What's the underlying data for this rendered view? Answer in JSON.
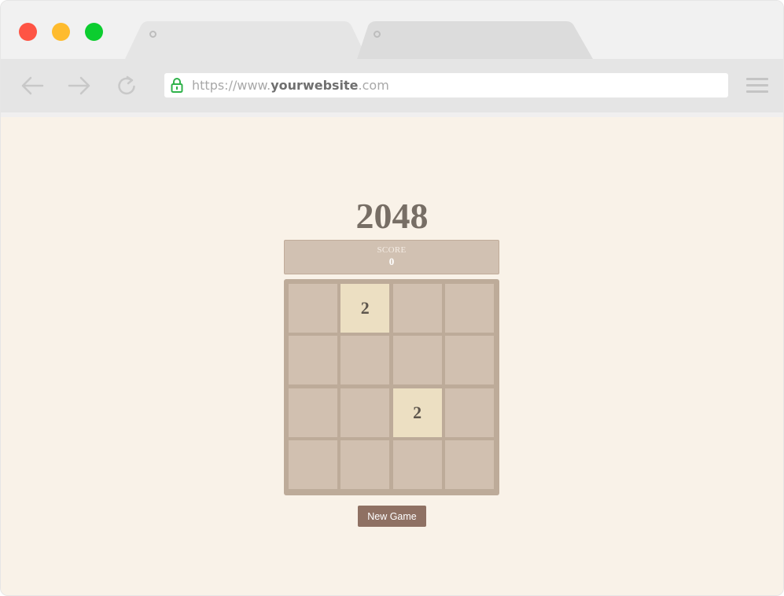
{
  "browser": {
    "window_controls": [
      "close",
      "minimize",
      "maximize"
    ],
    "tabs": [
      {
        "active": true
      },
      {
        "active": false
      }
    ],
    "url": {
      "scheme": "https://www.",
      "host": "yourwebsite",
      "tld": ".com"
    },
    "icons": {
      "back": "back-arrow-icon",
      "forward": "forward-arrow-icon",
      "reload": "reload-icon",
      "lock": "lock-icon",
      "menu": "hamburger-menu-icon"
    },
    "colors": {
      "lock": "#2fb24a",
      "close": "#fe5444",
      "minimize": "#febb2e",
      "maximize": "#0ccd2f"
    }
  },
  "game": {
    "title": "2048",
    "score_label": "SCORE",
    "score": "0",
    "grid": [
      [
        "",
        "2",
        "",
        ""
      ],
      [
        "",
        "",
        "",
        ""
      ],
      [
        "",
        "",
        "2",
        ""
      ],
      [
        "",
        "",
        "",
        ""
      ]
    ],
    "new_game_label": "New Game",
    "colors": {
      "background": "#f9f2e8",
      "board": "#bdab99",
      "empty_cell": "#d1c0b0",
      "tile_2": "#ecdfc2",
      "button": "#8f7163"
    }
  }
}
